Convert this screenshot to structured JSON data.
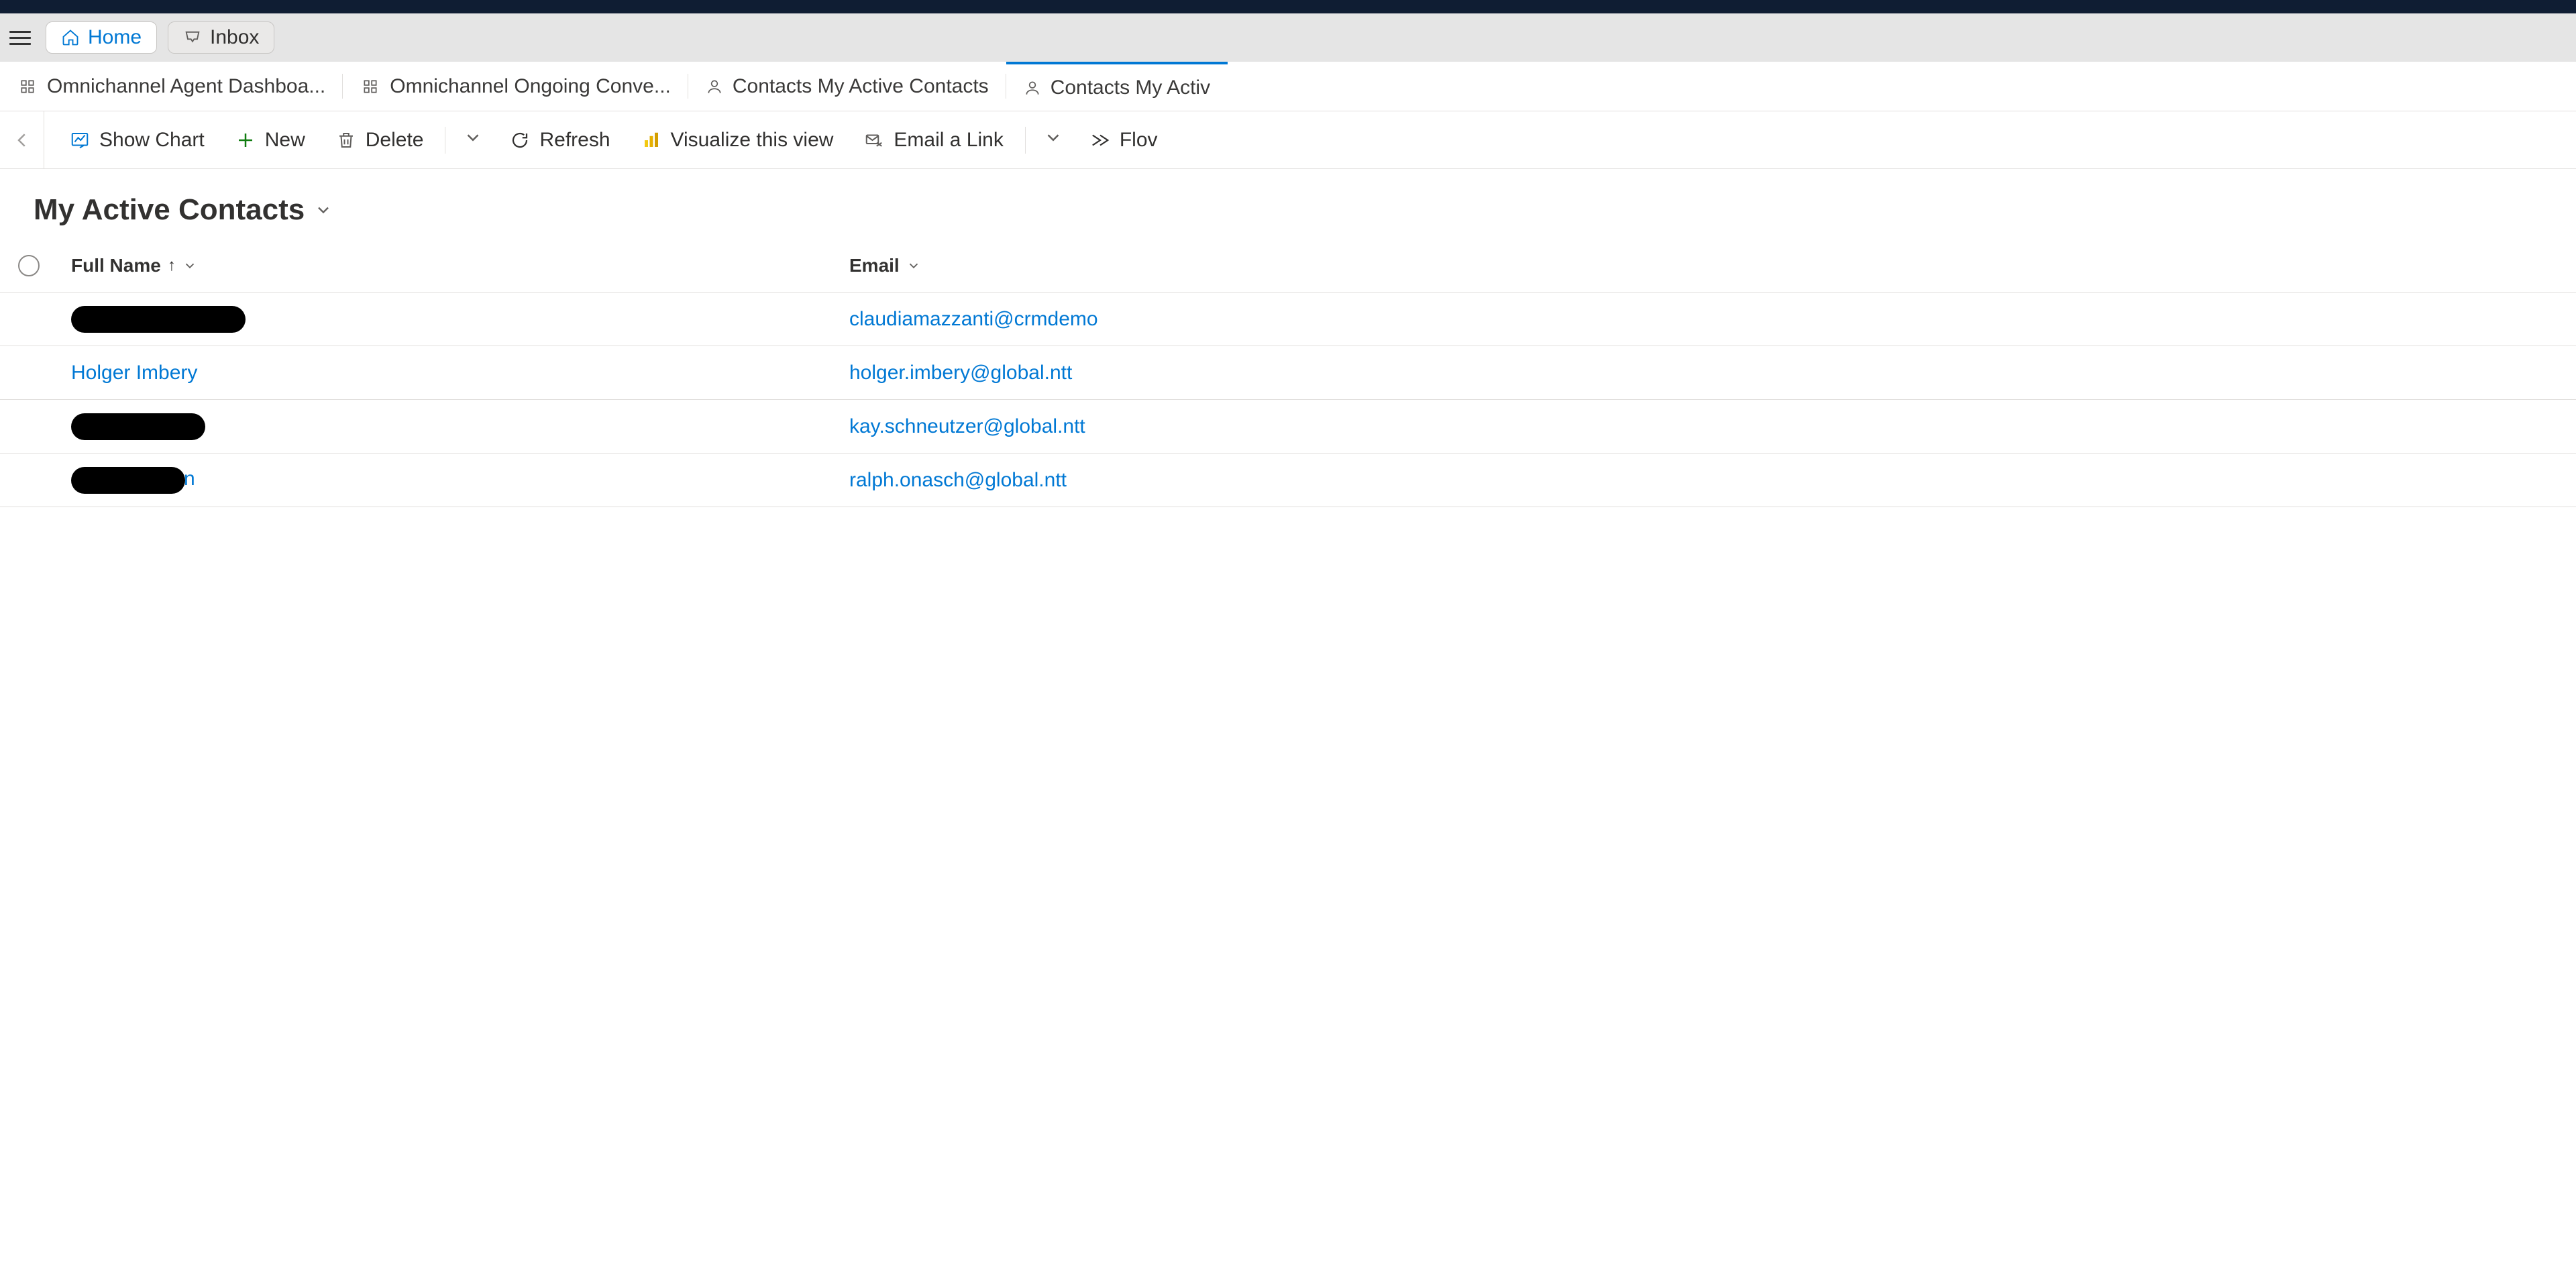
{
  "nav": {
    "home_label": "Home",
    "inbox_label": "Inbox"
  },
  "tabs": [
    {
      "label": "Omnichannel Agent Dashboa...",
      "icon": "omni"
    },
    {
      "label": "Omnichannel Ongoing Conve...",
      "icon": "omni"
    },
    {
      "label": "Contacts My Active Contacts",
      "icon": "person"
    },
    {
      "label": "Contacts My Activ",
      "icon": "person",
      "active": true
    }
  ],
  "commands": {
    "show_chart": "Show Chart",
    "new": "New",
    "delete": "Delete",
    "refresh": "Refresh",
    "visualize": "Visualize this view",
    "email_link": "Email a Link",
    "flow": "Flov"
  },
  "view": {
    "title": "My Active Contacts"
  },
  "columns": {
    "full_name": "Full Name",
    "email": "Email"
  },
  "rows": [
    {
      "name_redacted": true,
      "redact_class": "w1",
      "name_suffix": "",
      "email": "claudiamazzanti@crmdemo"
    },
    {
      "name_redacted": false,
      "name": "Holger Imbery",
      "email": "holger.imbery@global.ntt"
    },
    {
      "name_redacted": true,
      "redact_class": "w2",
      "name_suffix": "",
      "email": "kay.schneutzer@global.ntt"
    },
    {
      "name_redacted": true,
      "redact_class": "w3",
      "name_suffix": "n",
      "email": "ralph.onasch@global.ntt"
    }
  ],
  "colors": {
    "accent": "#0078d4"
  }
}
